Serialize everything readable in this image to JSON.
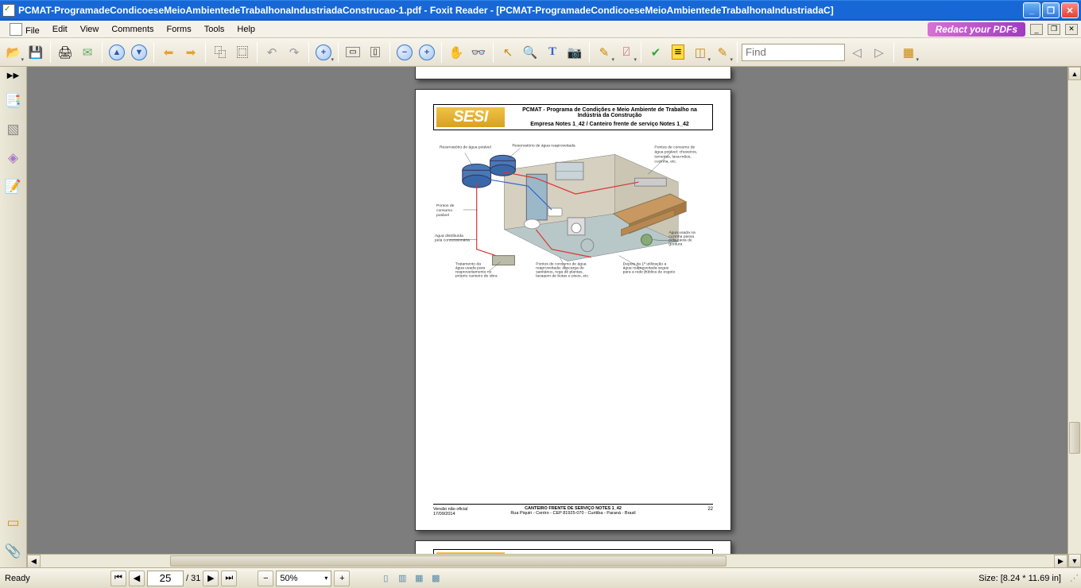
{
  "window": {
    "title": "PCMAT-ProgramadeCondicoeseMeioAmbientedeTrabalhonaIndustriadaConstrucao-1.pdf - Foxit Reader - [PCMAT-ProgramadeCondicoeseMeioAmbientedeTrabalhonaIndustriadaC]"
  },
  "menu": {
    "file": "File",
    "edit": "Edit",
    "view": "View",
    "comments": "Comments",
    "forms": "Forms",
    "tools": "Tools",
    "help": "Help"
  },
  "ad": {
    "text": "Redact your PDFs"
  },
  "toolbar": {
    "find_placeholder": "Find"
  },
  "status": {
    "ready": "Ready",
    "page_current": "25",
    "page_sep": "/ 31",
    "zoom": "50%",
    "size": "Size: [8.24 * 11.69 in]"
  },
  "document": {
    "logo": "SESI",
    "header_line1": "PCMAT -  Programa de Condições e  Meio Ambiente de Trabalho na",
    "header_line2": "Indústria da Construção",
    "header_line3": "Empresa Notes 1_42 / Canteiro frente de serviço Notes 1_42",
    "footer_left1": "Versão não oficial",
    "footer_left2": "17/09/2014",
    "footer_center1": "CANTEIRO FRENTE DE SERVIÇO NOTES 1_42",
    "footer_center2": "Rua Piquiri - Centro - CEP 81925-070 - Curitiba - Paraná - Brasil",
    "footer_page": "22",
    "labels": {
      "l1": "Reservatório de água potável",
      "l2": "Reservatório de água reaproveitada",
      "l3": "Pontos de consumo de água potável: chuveiros, torneiras, lava-mãos, cozinha, etc.",
      "l4": "Pontos de consumo potável",
      "l5": "Água distribuída pela concessionária",
      "l6": "Tratamento da água usada para reaproveitamento no próprio canteiro de obra",
      "l7": "Pontos de consumo de água reaproveitada: descarga de sanitários, rega de plantas, lavagem de botas e pisos, etc.",
      "l8": "Depois da 1ª utilização a água reaproveitada segue para a rede pública de esgoto",
      "l9": "Água usada na cozinha passa pela caixa de gordura"
    }
  }
}
